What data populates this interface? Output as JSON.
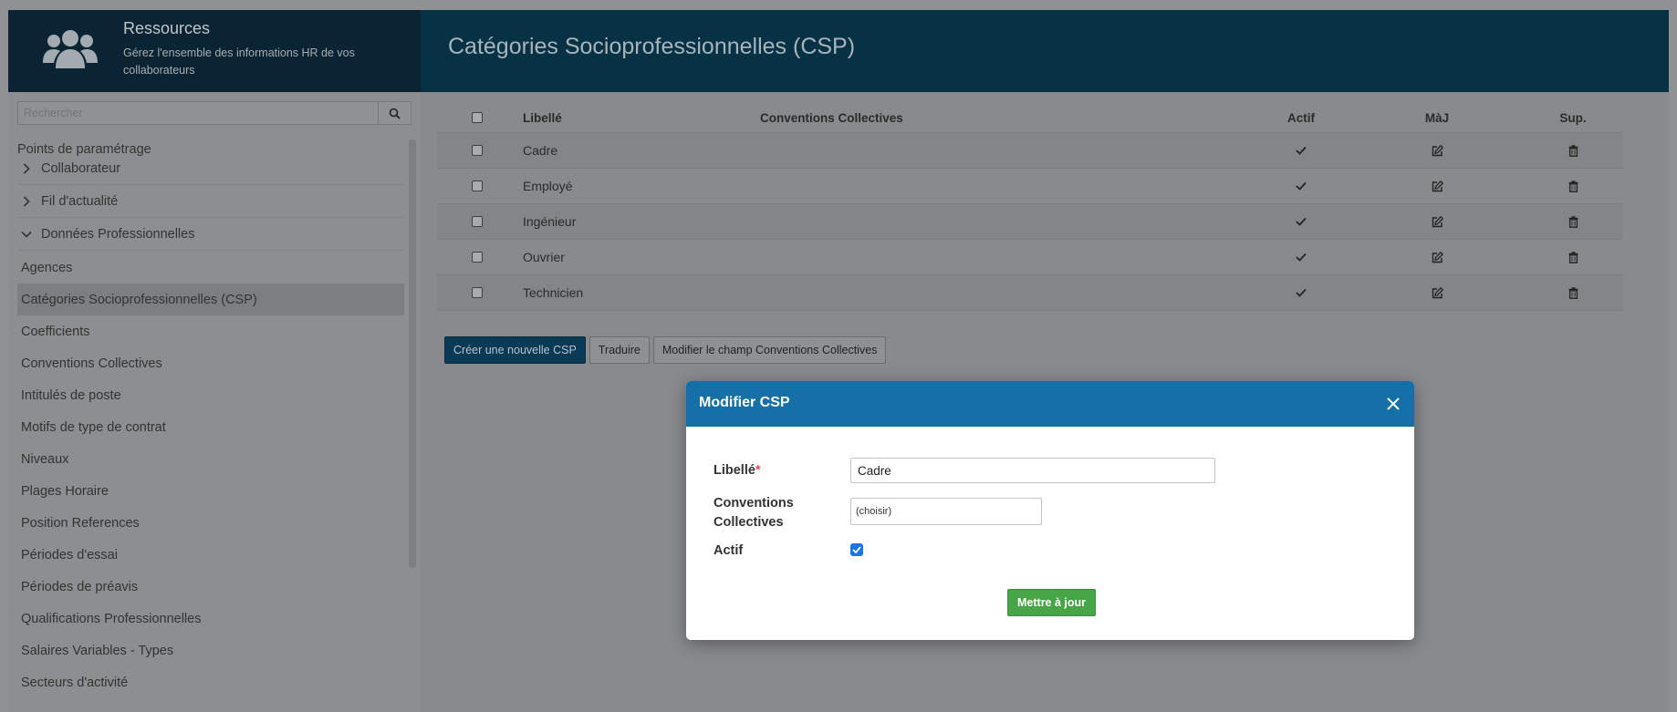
{
  "header": {
    "app_title": "Ressources",
    "app_subtitle": "Gérez l'ensemble des informations HR de vos collaborateurs",
    "page_title": "Catégories Socioprofessionnelles (CSP)"
  },
  "sidebar": {
    "search_placeholder": "Rechercher",
    "section_title": "Points de paramétrage",
    "groups": [
      {
        "label": "Collaborateur",
        "expanded": false
      },
      {
        "label": "Fil d'actualité",
        "expanded": false
      },
      {
        "label": "Données Professionnelles",
        "expanded": true
      }
    ],
    "items": [
      {
        "label": "Agences"
      },
      {
        "label": "Catégories Socioprofessionnelles (CSP)",
        "active": true
      },
      {
        "label": "Coefficients"
      },
      {
        "label": "Conventions Collectives"
      },
      {
        "label": "Intitulés de poste"
      },
      {
        "label": "Motifs de type de contrat"
      },
      {
        "label": "Niveaux"
      },
      {
        "label": "Plages Horaire"
      },
      {
        "label": "Position References"
      },
      {
        "label": "Périodes d'essai"
      },
      {
        "label": "Périodes de préavis"
      },
      {
        "label": "Qualifications Professionnelles"
      },
      {
        "label": "Salaires Variables - Types"
      },
      {
        "label": "Secteurs d'activité"
      }
    ]
  },
  "table": {
    "columns": {
      "libelle": "Libellé",
      "conventions": "Conventions Collectives",
      "actif": "Actif",
      "maj": "MàJ",
      "sup": "Sup."
    },
    "rows": [
      {
        "libelle": "Cadre",
        "conventions": "",
        "actif": true
      },
      {
        "libelle": "Employé",
        "conventions": "",
        "actif": true
      },
      {
        "libelle": "Ingénieur",
        "conventions": "",
        "actif": true
      },
      {
        "libelle": "Ouvrier",
        "conventions": "",
        "actif": true
      },
      {
        "libelle": "Technicien",
        "conventions": "",
        "actif": true
      }
    ]
  },
  "actions": {
    "create": "Créer une nouvelle CSP",
    "translate": "Traduire",
    "modify_field": "Modifier le champ Conventions Collectives"
  },
  "modal": {
    "title": "Modifier CSP",
    "libelle_label": "Libellé",
    "required_mark": "*",
    "libelle_value": "Cadre",
    "conventions_label": "Conventions Collectives",
    "conventions_value": "(choisir)",
    "actif_label": "Actif",
    "actif_checked": true,
    "submit": "Mettre à jour"
  },
  "colors": {
    "header_main": "#073245",
    "header_side": "#0b2433",
    "primary_button": "#0a3a56",
    "modal_header": "#1570a8",
    "submit_button": "#47a447"
  },
  "icons": {
    "logo": "users-icon",
    "search": "search-icon",
    "actif": "check-icon",
    "maj": "edit-icon",
    "sup": "trash-icon",
    "close": "close-icon"
  }
}
